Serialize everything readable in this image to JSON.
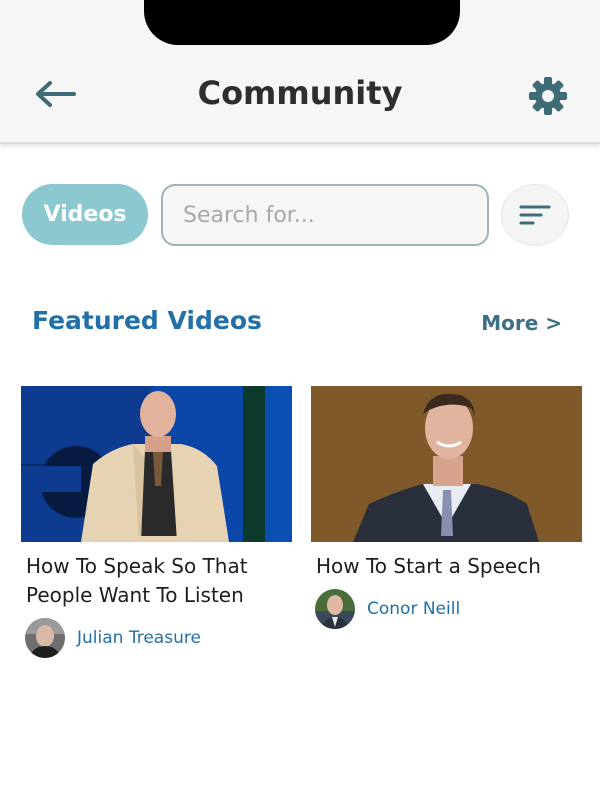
{
  "header": {
    "title": "Community"
  },
  "search": {
    "category_label": "Videos",
    "placeholder": "Search for..."
  },
  "section": {
    "title": "Featured Videos",
    "more_label": "More >"
  },
  "videos": [
    {
      "title": "How To Speak So That People Want To Listen",
      "author": "Julian Treasure"
    },
    {
      "title": "How To Start a Speech",
      "author": "Conor Neill"
    }
  ],
  "colors": {
    "accent_chip": "#8cc8cf",
    "link_blue": "#2370a8",
    "icon_teal": "#3e6c77"
  },
  "icons": {
    "back": "arrow-left-icon",
    "settings": "gear-icon",
    "filter": "filter-lines-icon"
  }
}
